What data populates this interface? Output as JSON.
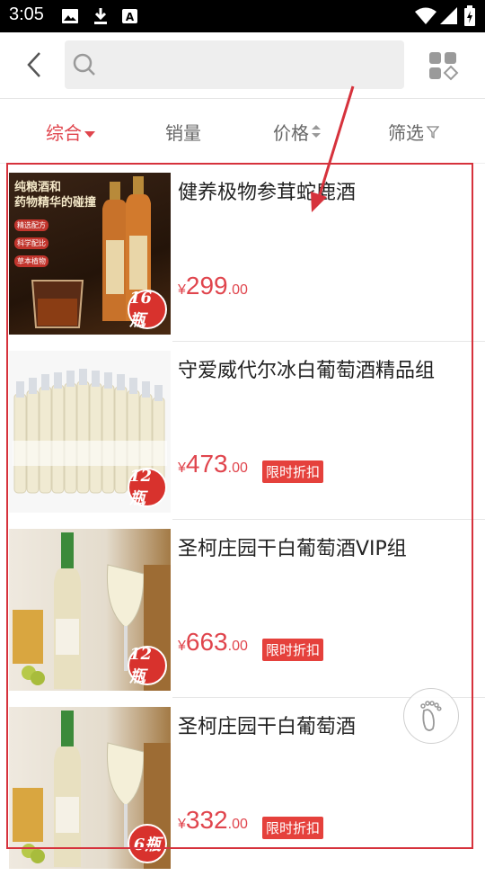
{
  "status_bar": {
    "time": "3:05",
    "left_icons": [
      "image-icon",
      "download-icon",
      "a-box-icon"
    ],
    "right_icons": [
      "wifi-icon",
      "signal-icon",
      "battery-icon"
    ]
  },
  "header": {
    "search_placeholder": "",
    "search_value": ""
  },
  "tabs": [
    {
      "label": "综合",
      "active": true,
      "icon": "caret-down-icon"
    },
    {
      "label": "销量",
      "active": false
    },
    {
      "label": "价格",
      "active": false,
      "icon": "sort-updown-icon"
    },
    {
      "label": "筛选",
      "active": false,
      "icon": "filter-icon"
    }
  ],
  "products": [
    {
      "name": "健养极物参茸蛇鹿酒",
      "price_symbol": "¥",
      "price_int": "299",
      "price_dec": ".00",
      "badge": "",
      "count_label": "16瓶",
      "image_text": [
        "纯粮酒和",
        "药物精华的碰撞",
        "精选配方",
        "科学配比",
        "草本植物"
      ]
    },
    {
      "name": "守爱威代尔冰白葡萄酒精品组",
      "price_symbol": "¥",
      "price_int": "473",
      "price_dec": ".00",
      "badge": "限时折扣",
      "count_label": "12瓶"
    },
    {
      "name": "圣柯庄园干白葡萄酒VIP组",
      "price_symbol": "¥",
      "price_int": "663",
      "price_dec": ".00",
      "badge": "限时折扣",
      "count_label": "12瓶"
    },
    {
      "name": "圣柯庄园干白葡萄酒",
      "price_symbol": "¥",
      "price_int": "332",
      "price_dec": ".00",
      "badge": "限时折扣",
      "count_label": "6瓶"
    }
  ],
  "colors": {
    "accent": "#e0454d",
    "badge_bg": "#e5413c",
    "annotation": "#d6323c"
  }
}
